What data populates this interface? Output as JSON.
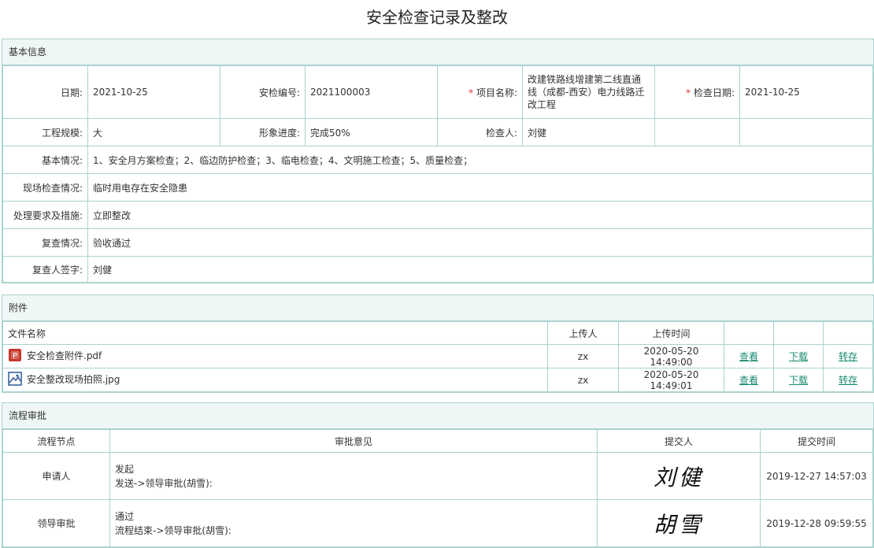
{
  "page": {
    "title": "安全检查记录及整改"
  },
  "basic": {
    "header": "基本信息",
    "date_label": "日期:",
    "date_value": "2021-10-25",
    "inspect_no_label": "安检编号:",
    "inspect_no_value": "2021100003",
    "project_required": "*",
    "project_label": "项目名称:",
    "project_value": "改建铁路线增建第二线直通线（成都-西安）电力线路迁改工程",
    "check_date_required": "*",
    "check_date_label": "检查日期:",
    "check_date_value": "2021-10-25",
    "scale_label": "工程规模:",
    "scale_value": "大",
    "progress_label": "形象进度:",
    "progress_value": "完成50%",
    "inspector_label": "检查人:",
    "inspector_value": "刘健",
    "basic_label": "基本情况:",
    "basic_value": "1、安全月方案检查；2、临边防护检查；3、临电检查；4、文明施工检查；5、质量检查；",
    "site_label": "现场检查情况:",
    "site_value": "临时用电存在安全隐患",
    "handle_label": "处理要求及措施:",
    "handle_value": "立即整改",
    "recheck_label": "复查情况:",
    "recheck_value": "验收通过",
    "sign_label": "复查人签字:",
    "sign_value": "刘健"
  },
  "attachments": {
    "header": "附件",
    "columns": {
      "name": "文件名称",
      "uploader": "上传人",
      "time": "上传时间"
    },
    "rows": [
      {
        "icon": "pdf-file-icon",
        "name": "安全检查附件.pdf",
        "uploader": "zx",
        "time": "2020-05-20 14:49:00",
        "view": "查看",
        "download": "下载",
        "transfer": "转存"
      },
      {
        "icon": "image-file-icon",
        "name": "安全整改现场拍照.jpg",
        "uploader": "zx",
        "time": "2020-05-20 14:49:01",
        "view": "查看",
        "download": "下载",
        "transfer": "转存"
      }
    ]
  },
  "flow": {
    "header": "流程审批",
    "columns": {
      "node": "流程节点",
      "opinion": "审批意见",
      "submitter": "提交人",
      "time": "提交时间"
    },
    "rows": [
      {
        "node": "申请人",
        "opinion": "发起",
        "detail": "发送->领导审批(胡雪):",
        "signature": "刘健",
        "time": "2019-12-27 14:57:03"
      },
      {
        "node": "领导审批",
        "opinion": "通过",
        "detail": "流程结束->领导审批(胡雪):",
        "signature": "胡雪",
        "time": "2019-12-28 09:59:55"
      }
    ]
  },
  "colors": {
    "border": "#a9d3cf",
    "header_bg": "#eef7f6",
    "link": "#1a8a70",
    "required": "#e03030"
  }
}
